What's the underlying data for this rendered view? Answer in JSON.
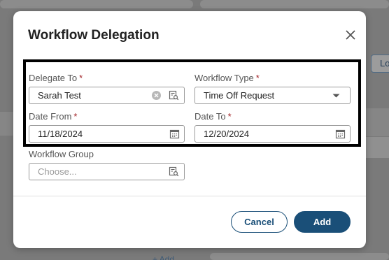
{
  "background": {
    "button_partial": "Lo",
    "add_link_partial": "+ Add"
  },
  "modal": {
    "title": "Workflow Delegation",
    "fields": {
      "delegate_to": {
        "label": "Delegate To",
        "value": "Sarah Test",
        "required": true
      },
      "workflow_type": {
        "label": "Workflow Type",
        "value": "Time Off Request",
        "required": true
      },
      "date_from": {
        "label": "Date From",
        "value": "11/18/2024",
        "required": true
      },
      "date_to": {
        "label": "Date To",
        "value": "12/20/2024",
        "required": true
      },
      "workflow_group": {
        "label": "Workflow Group",
        "placeholder": "Choose...",
        "required": false
      }
    },
    "required_marker": "*",
    "buttons": {
      "cancel": "Cancel",
      "add": "Add"
    }
  },
  "colors": {
    "primary": "#1a4f78",
    "required": "#a3262a",
    "highlight": "#000000"
  },
  "icons": {
    "close": "close-icon",
    "clear": "clear-icon",
    "lookup": "lookup-icon",
    "calendar": "calendar-icon",
    "dropdown": "chevron-down-icon"
  }
}
